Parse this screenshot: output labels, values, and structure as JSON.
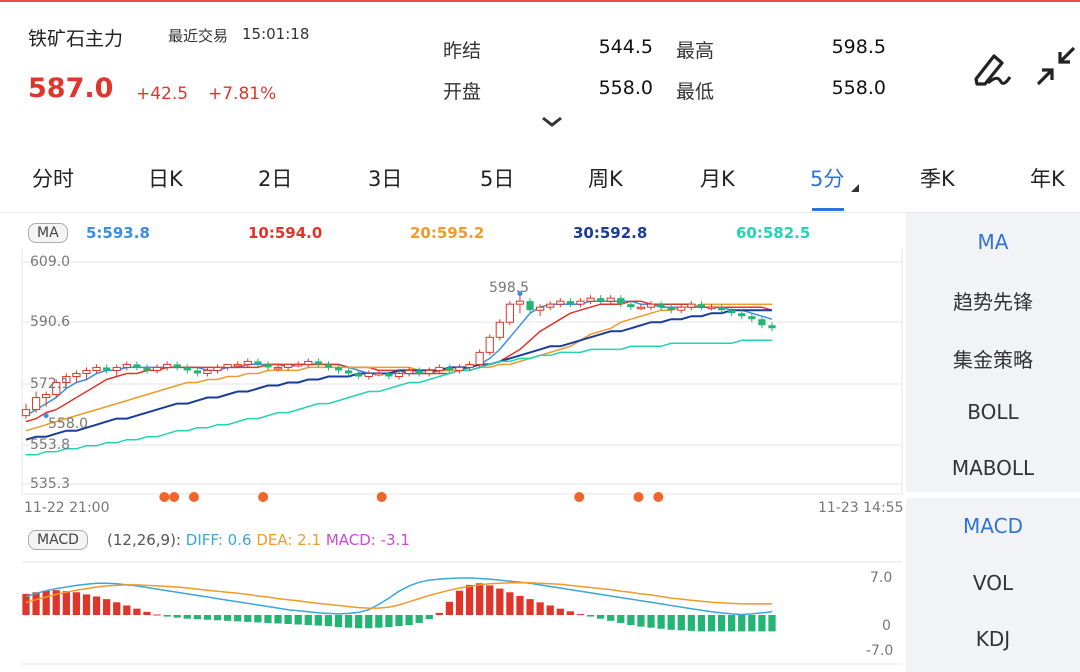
{
  "header": {
    "name": "铁矿石主力",
    "trade_label": "最近交易",
    "time": "15:01:18",
    "price": "587.0",
    "change": "+42.5",
    "change_pct": "+7.81%"
  },
  "stats": [
    {
      "label": "昨结",
      "value": "544.5"
    },
    {
      "label": "最高",
      "value": "598.5"
    },
    {
      "label": "开盘",
      "value": "558.0"
    },
    {
      "label": "最低",
      "value": "558.0"
    }
  ],
  "tabs": [
    {
      "label": "分时"
    },
    {
      "label": "日K"
    },
    {
      "label": "2日"
    },
    {
      "label": "3日"
    },
    {
      "label": "5日"
    },
    {
      "label": "周K"
    },
    {
      "label": "月K"
    },
    {
      "label": "5分"
    },
    {
      "label": "季K"
    },
    {
      "label": "年K"
    }
  ],
  "active_tab": "5分",
  "side_menu": {
    "main": [
      "MA",
      "趋势先锋",
      "集金策略",
      "BOLL",
      "MABOLL"
    ],
    "sub": [
      "MACD",
      "VOL",
      "KDJ"
    ]
  },
  "ma": {
    "badge": "MA",
    "items": [
      {
        "label": "5:593.8",
        "color": "#3a8ee6"
      },
      {
        "label": "10:594.0",
        "color": "#e0352b"
      },
      {
        "label": "20:595.2",
        "color": "#f09a2a"
      },
      {
        "label": "30:592.8",
        "color": "#1c3c9c"
      },
      {
        "label": "60:582.5",
        "color": "#21d4b4"
      }
    ]
  },
  "price_axis": {
    "top": "609.0",
    "mid": "590.6",
    "low1": "572.1",
    "low2": "553.8",
    "bottom": "535.3"
  },
  "annotations": {
    "high": "598.5",
    "low": "558.0"
  },
  "time_axis": {
    "start": "11-22 21:00",
    "end": "11-23 14:55"
  },
  "macd": {
    "badge": "MACD",
    "params": "(12,26,9):",
    "diff": "DIFF: 0.6",
    "dea": "DEA: 2.1",
    "macd": "MACD: -3.1",
    "axis_top": "7.0",
    "axis_mid": "0",
    "axis_bottom": "-7.0"
  },
  "colors": {
    "up": "#e0352b",
    "down": "#22b573",
    "accent": "#2f73d8",
    "signal_dot": "#f0652a"
  },
  "chart_data": {
    "type": "candlestick",
    "ylim": [
      535.3,
      609.0
    ],
    "candles": [
      [
        558,
        562,
        557,
        560
      ],
      [
        560,
        566,
        559,
        564
      ],
      [
        564,
        566,
        561,
        565
      ],
      [
        565,
        570,
        564,
        569
      ],
      [
        569,
        572,
        568,
        571
      ],
      [
        571,
        573,
        569,
        572
      ],
      [
        572,
        574,
        570,
        573
      ],
      [
        573,
        575,
        572,
        574
      ],
      [
        574,
        575,
        572,
        573
      ],
      [
        573,
        575,
        571,
        574
      ],
      [
        574,
        576,
        573,
        575
      ],
      [
        575,
        576,
        573,
        574
      ],
      [
        574,
        575,
        572,
        573
      ],
      [
        573,
        575,
        572,
        574
      ],
      [
        574,
        576,
        573,
        575
      ],
      [
        575,
        576,
        573,
        574
      ],
      [
        574,
        575,
        572,
        573
      ],
      [
        573,
        574,
        571,
        572
      ],
      [
        572,
        574,
        571,
        573
      ],
      [
        573,
        575,
        572,
        574
      ],
      [
        574,
        575,
        573,
        575
      ],
      [
        575,
        576,
        574,
        575
      ],
      [
        575,
        577,
        574,
        576
      ],
      [
        576,
        577,
        574,
        575
      ],
      [
        575,
        576,
        573,
        574
      ],
      [
        574,
        575,
        573,
        574
      ],
      [
        574,
        575,
        573,
        575
      ],
      [
        575,
        576,
        574,
        575
      ],
      [
        575,
        577,
        574,
        576
      ],
      [
        576,
        577,
        574,
        575
      ],
      [
        575,
        576,
        573,
        574
      ],
      [
        574,
        575,
        572,
        573
      ],
      [
        573,
        574,
        571,
        572
      ],
      [
        572,
        573,
        570,
        571
      ],
      [
        571,
        573,
        570,
        572
      ],
      [
        572,
        573,
        571,
        572
      ],
      [
        572,
        573,
        570,
        571
      ],
      [
        571,
        573,
        570,
        572
      ],
      [
        572,
        574,
        571,
        573
      ],
      [
        573,
        574,
        571,
        572
      ],
      [
        572,
        574,
        571,
        573
      ],
      [
        573,
        575,
        572,
        574
      ],
      [
        574,
        575,
        572,
        573
      ],
      [
        573,
        575,
        572,
        574
      ],
      [
        574,
        576,
        573,
        575
      ],
      [
        575,
        580,
        574,
        579
      ],
      [
        579,
        585,
        578,
        584
      ],
      [
        584,
        590,
        583,
        589
      ],
      [
        589,
        596,
        588,
        595
      ],
      [
        595,
        598.5,
        592,
        596
      ],
      [
        596,
        597,
        592,
        593
      ],
      [
        593,
        595,
        591,
        594
      ],
      [
        594,
        596,
        593,
        595
      ],
      [
        595,
        597,
        594,
        596
      ],
      [
        596,
        597,
        594,
        595
      ],
      [
        595,
        597,
        594,
        596
      ],
      [
        596,
        598,
        595,
        597
      ],
      [
        597,
        598,
        595,
        596
      ],
      [
        596,
        598,
        595,
        597
      ],
      [
        597,
        598,
        594,
        595
      ],
      [
        595,
        596,
        593,
        594
      ],
      [
        594,
        595,
        593,
        594
      ],
      [
        594,
        596,
        593,
        595
      ],
      [
        595,
        596,
        593,
        594
      ],
      [
        594,
        595,
        592,
        593
      ],
      [
        593,
        595,
        592,
        594
      ],
      [
        594,
        596,
        593,
        595
      ],
      [
        595,
        596,
        593,
        594
      ],
      [
        594,
        595,
        593,
        594
      ],
      [
        594,
        595,
        592,
        593
      ],
      [
        593,
        594,
        591,
        592
      ],
      [
        592,
        593,
        590,
        591
      ],
      [
        591,
        592,
        589,
        590
      ],
      [
        590,
        591,
        587,
        588
      ],
      [
        588,
        589,
        586,
        587
      ]
    ],
    "ma_series": [
      {
        "name": "5",
        "values": [
          558,
          560,
          562,
          564,
          567,
          569,
          570,
          572,
          573,
          573,
          574,
          574,
          574,
          574,
          574,
          574,
          574,
          574,
          573,
          573,
          574,
          574,
          575,
          575,
          575,
          575,
          574,
          575,
          575,
          575,
          575,
          575,
          574,
          573,
          572,
          572,
          572,
          572,
          572,
          572,
          572,
          573,
          573,
          573,
          574,
          575,
          577,
          580,
          584,
          588,
          592,
          594,
          595,
          595,
          595,
          595,
          596,
          596,
          596,
          596,
          596,
          595,
          595,
          594,
          594,
          594,
          594,
          594,
          594,
          594,
          593,
          593,
          592,
          591,
          590
        ]
      },
      {
        "name": "10",
        "values": [
          556,
          557,
          559,
          560,
          562,
          564,
          566,
          568,
          570,
          571,
          572,
          572,
          573,
          573,
          574,
          574,
          574,
          574,
          574,
          574,
          574,
          574,
          574,
          574,
          575,
          575,
          575,
          575,
          575,
          575,
          575,
          575,
          574,
          574,
          574,
          573,
          573,
          573,
          572,
          572,
          572,
          572,
          572,
          573,
          573,
          574,
          575,
          576,
          578,
          580,
          583,
          586,
          588,
          590,
          592,
          593,
          594,
          595,
          595,
          595,
          596,
          596,
          595,
          595,
          595,
          595,
          595,
          594,
          594,
          594,
          594,
          594,
          594,
          594,
          593
        ]
      },
      {
        "name": "20",
        "values": [
          553,
          554,
          555,
          556,
          557,
          558,
          559,
          560,
          561,
          562,
          563,
          564,
          565,
          566,
          567,
          568,
          569,
          569,
          570,
          570,
          571,
          571,
          572,
          572,
          573,
          573,
          573,
          573,
          574,
          574,
          574,
          574,
          574,
          574,
          574,
          574,
          574,
          574,
          574,
          573,
          573,
          573,
          573,
          573,
          573,
          574,
          574,
          575,
          575,
          576,
          577,
          578,
          579,
          580,
          581,
          583,
          585,
          586,
          587,
          589,
          590,
          591,
          592,
          593,
          593,
          594,
          594,
          595,
          595,
          595,
          595,
          595,
          595,
          595,
          595
        ]
      },
      {
        "name": "30",
        "values": [
          550,
          551,
          551,
          552,
          553,
          553,
          554,
          555,
          556,
          557,
          557,
          558,
          559,
          560,
          561,
          562,
          562,
          563,
          564,
          564,
          565,
          566,
          566,
          567,
          568,
          568,
          569,
          569,
          570,
          570,
          571,
          571,
          571,
          572,
          572,
          572,
          572,
          573,
          573,
          573,
          573,
          573,
          574,
          574,
          574,
          575,
          575,
          576,
          577,
          578,
          579,
          580,
          581,
          581,
          582,
          583,
          584,
          585,
          586,
          586,
          587,
          588,
          589,
          589,
          590,
          590,
          591,
          591,
          592,
          592,
          593,
          593,
          593,
          593,
          593
        ]
      },
      {
        "name": "60",
        "values": [
          545,
          545,
          546,
          546,
          547,
          547,
          548,
          548,
          549,
          549,
          550,
          550,
          551,
          551,
          552,
          553,
          553,
          554,
          554,
          555,
          555,
          556,
          557,
          557,
          558,
          559,
          559,
          560,
          561,
          562,
          562,
          563,
          564,
          565,
          566,
          566,
          567,
          568,
          569,
          569,
          570,
          571,
          572,
          573,
          573,
          574,
          575,
          576,
          576,
          577,
          577,
          578,
          578,
          579,
          579,
          579,
          580,
          580,
          580,
          580,
          581,
          581,
          581,
          581,
          582,
          582,
          582,
          582,
          582,
          582,
          582,
          583,
          583,
          583,
          583
        ]
      }
    ],
    "signal_dots_index": [
      14,
      15,
      17,
      24,
      36,
      56,
      62,
      64
    ],
    "macd_hist": [
      4,
      4.3,
      4.6,
      4.7,
      4.5,
      4.3,
      3.9,
      3.5,
      3,
      2.4,
      1.8,
      1.2,
      0.6,
      0.1,
      -0.3,
      -0.5,
      -0.7,
      -0.8,
      -0.9,
      -1,
      -1.1,
      -1.2,
      -1.3,
      -1.4,
      -1.5,
      -1.6,
      -1.7,
      -1.8,
      -1.9,
      -2,
      -2.1,
      -2.3,
      -2.4,
      -2.5,
      -2.5,
      -2.4,
      -2.3,
      -2.1,
      -1.9,
      -1.5,
      -0.8,
      0.4,
      2.5,
      4.6,
      5.7,
      6,
      5.6,
      5,
      4.3,
      3.6,
      3,
      2.4,
      1.8,
      1.2,
      0.7,
      0.2,
      -0.3,
      -0.7,
      -1.1,
      -1.5,
      -1.9,
      -2.2,
      -2.4,
      -2.6,
      -2.8,
      -2.9,
      -3,
      -3.1,
      -3.1,
      -3.1,
      -3.1,
      -3.1,
      -3.1,
      -3.1,
      -3.1
    ],
    "diff": [
      3.5,
      4.1,
      4.6,
      5,
      5.3,
      5.6,
      5.8,
      6,
      6,
      5.9,
      5.7,
      5.5,
      5.2,
      4.9,
      4.6,
      4.3,
      4,
      3.7,
      3.4,
      3.1,
      2.8,
      2.5,
      2.2,
      1.9,
      1.6,
      1.3,
      1.0,
      0.8,
      0.6,
      0.4,
      0.3,
      0.2,
      0.3,
      0.5,
      1,
      2,
      3.2,
      4.5,
      5.5,
      6.2,
      6.6,
      6.8,
      6.9,
      7,
      7,
      6.9,
      6.8,
      6.6,
      6.4,
      6.2,
      6,
      5.7,
      5.4,
      5.1,
      4.8,
      4.5,
      4.2,
      3.9,
      3.6,
      3.3,
      3,
      2.7,
      2.4,
      2.1,
      1.8,
      1.5,
      1.2,
      0.9,
      0.6,
      0.4,
      0.2,
      0.1,
      0.2,
      0.4,
      0.6
    ],
    "dea": [
      2.4,
      2.9,
      3.4,
      3.9,
      4.3,
      4.7,
      5,
      5.3,
      5.5,
      5.6,
      5.7,
      5.7,
      5.6,
      5.5,
      5.4,
      5.3,
      5.1,
      4.9,
      4.7,
      4.5,
      4.3,
      4.1,
      3.9,
      3.6,
      3.4,
      3.1,
      2.9,
      2.7,
      2.4,
      2.2,
      2,
      1.8,
      1.6,
      1.4,
      1.3,
      1.3,
      1.5,
      1.9,
      2.5,
      3.1,
      3.7,
      4.2,
      4.7,
      5.1,
      5.4,
      5.7,
      5.9,
      6,
      6.1,
      6.1,
      6.1,
      6,
      5.9,
      5.8,
      5.6,
      5.4,
      5.2,
      5,
      4.8,
      4.5,
      4.3,
      4,
      3.8,
      3.5,
      3.2,
      3,
      2.8,
      2.6,
      2.4,
      2.3,
      2.2,
      2.1,
      2.1,
      2.1,
      2.1
    ],
    "macd_ylim": [
      -7.0,
      7.0
    ]
  }
}
